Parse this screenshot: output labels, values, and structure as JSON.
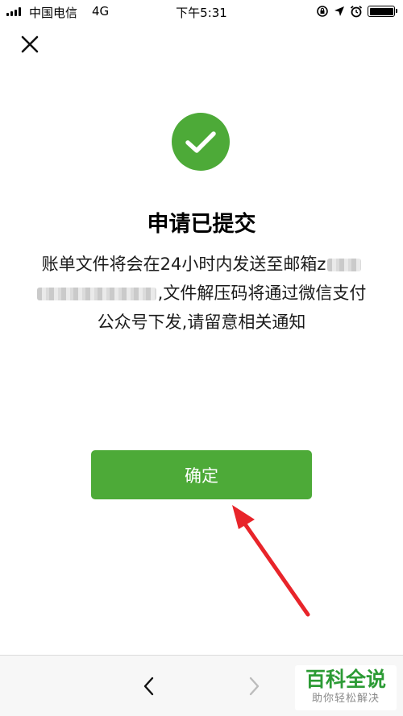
{
  "status_bar": {
    "carrier": "中国电信",
    "network": "4G",
    "time": "下午5:31",
    "icons": [
      "screen-rotation-lock-icon",
      "location-arrow-icon",
      "alarm-icon",
      "battery-icon"
    ]
  },
  "header": {
    "close_icon": "close-icon"
  },
  "result": {
    "icon": "success-check-icon",
    "icon_color": "#4daa38",
    "title": "申请已提交",
    "message_part1": "账单文件将会在24小时内发送至邮箱z",
    "message_part2": ",文件解压码将通过微信支付",
    "message_part3": "公众号下发,请留意相关通知"
  },
  "actions": {
    "confirm_label": "确定",
    "confirm_color": "#4daa38"
  },
  "annotation": {
    "arrow_color": "#e8242a"
  },
  "bottom_nav": {
    "back_icon": "chevron-left-icon",
    "forward_icon": "chevron-right-icon"
  },
  "watermark": {
    "title": "百科全说",
    "subtitle": "助你轻松解决"
  }
}
